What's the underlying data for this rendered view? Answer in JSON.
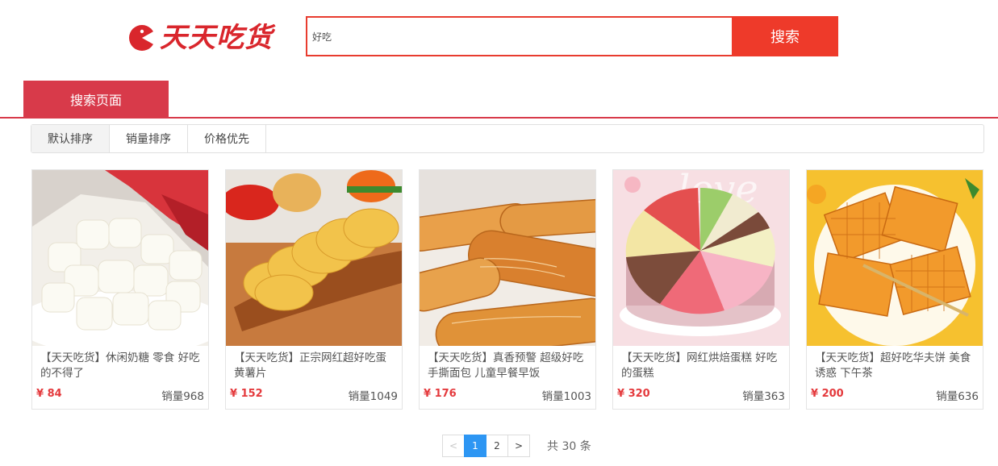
{
  "brand": {
    "name": "天天吃货",
    "accent": "#d9262c"
  },
  "search": {
    "value": "好吃",
    "button_label": "搜索"
  },
  "tabs": {
    "active_label": "搜索页面"
  },
  "sort": {
    "options": [
      "默认排序",
      "销量排序",
      "价格优先"
    ],
    "active_index": 0
  },
  "products": [
    {
      "title": "【天天吃货】休闲奶糖 零食 好吃的不得了",
      "price": "¥ 84",
      "sales": "销量968",
      "image": "milk-candy"
    },
    {
      "title": "【天天吃货】正宗网红超好吃蛋黄薯片",
      "price": "¥ 152",
      "sales": "销量1049",
      "image": "potato-chips"
    },
    {
      "title": "【天天吃货】真香预警 超级好吃 手撕面包 儿童早餐早饭",
      "price": "¥ 176",
      "sales": "销量1003",
      "image": "hand-torn-bread"
    },
    {
      "title": "【天天吃货】网红烘焙蛋糕 好吃的蛋糕",
      "price": "¥ 320",
      "sales": "销量363",
      "image": "rainbow-cake"
    },
    {
      "title": "【天天吃货】超好吃华夫饼 美食诱惑 下午茶",
      "price": "¥ 200",
      "sales": "销量636",
      "image": "waffles"
    }
  ],
  "pagination": {
    "prev": "<",
    "pages": [
      "1",
      "2"
    ],
    "current": "1",
    "next": ">",
    "total": "共 30 条"
  },
  "colors": {
    "tab": "#d83a4a",
    "search_button": "#ee3a2a",
    "price": "#e4393c",
    "pager_current": "#2d96f3"
  }
}
